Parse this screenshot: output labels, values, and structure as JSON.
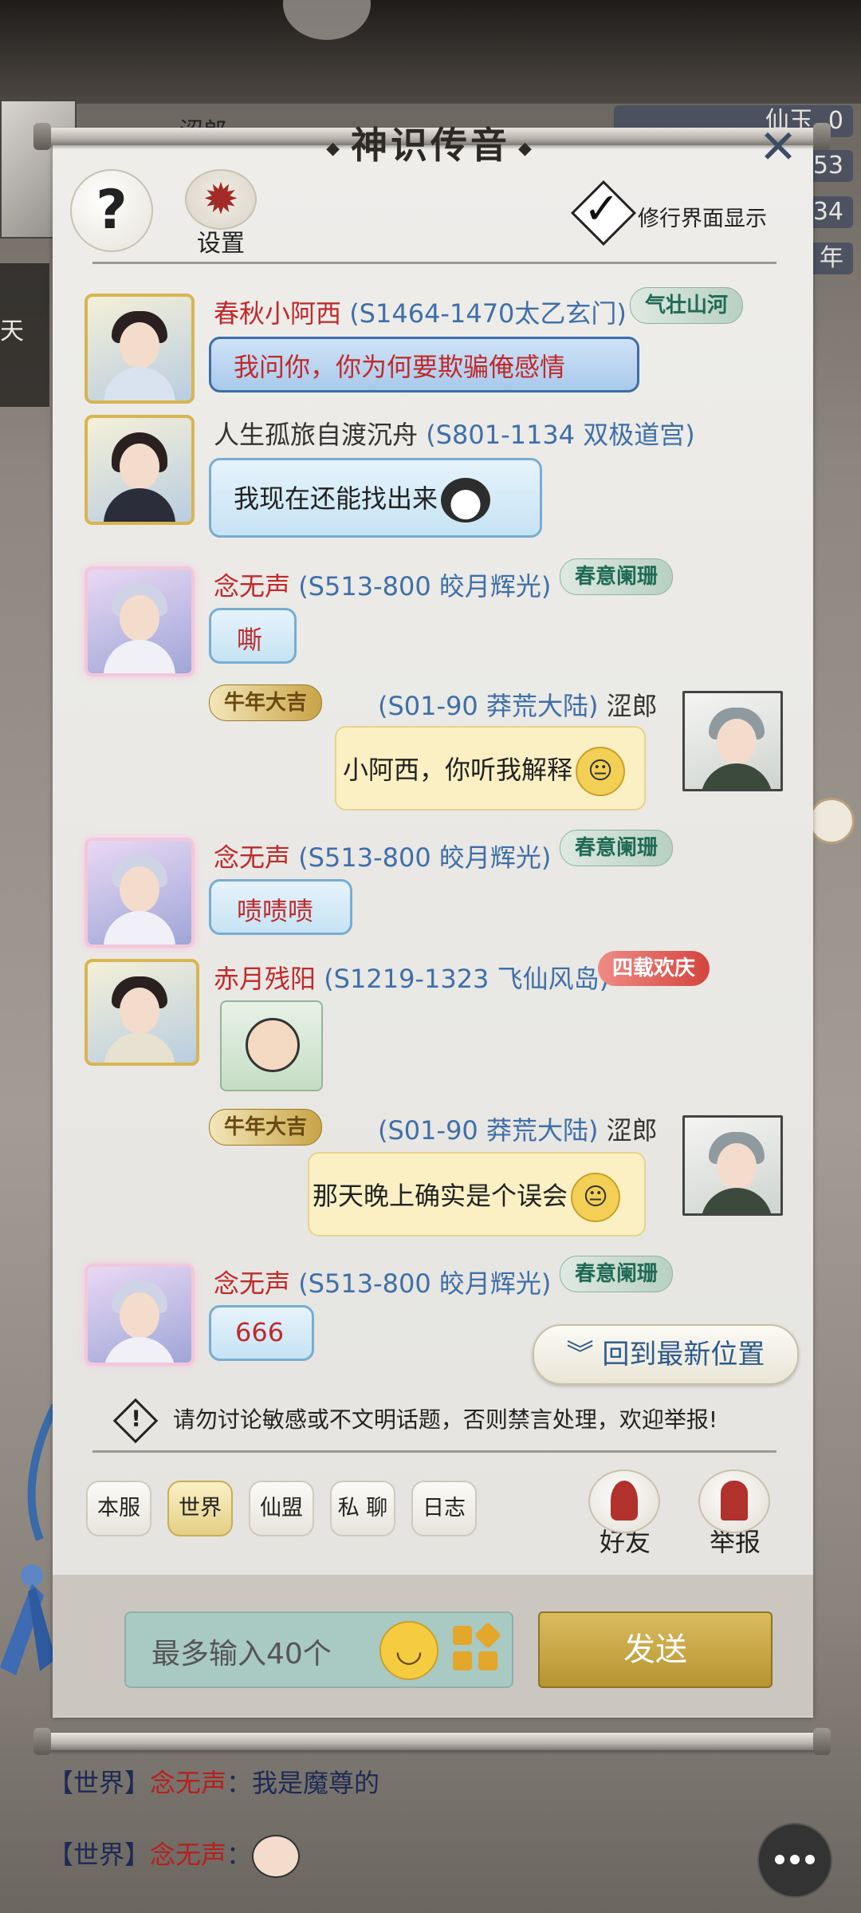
{
  "background": {
    "player_name": "涩郎",
    "stats": [
      "仙玉",
      "0",
      "53",
      "34",
      "年"
    ],
    "side_label": "天",
    "chat_preview": [
      {
        "channel": "【世界】",
        "sender": "念无声",
        "text": "我是魔尊的"
      },
      {
        "channel": "【世界】",
        "sender": "念无声",
        "text": ""
      }
    ]
  },
  "panel": {
    "title": "神识传音",
    "close_icon": "close-icon",
    "settings_label": "设置",
    "display_toggle_label": "修行界面显示",
    "display_toggle_checked": true
  },
  "messages": [
    {
      "name": "春秋小阿西",
      "server": "(S1464-1470太乙玄门)",
      "badge": "气壮山河",
      "text": "我问你，你为何要欺骗俺感情",
      "side": "left"
    },
    {
      "name": "人生孤旅自渡沉舟",
      "server": "(S801-1134 双极道宫)",
      "badge": "",
      "text": "我现在还能找出来",
      "side": "left"
    },
    {
      "name": "念无声",
      "server": "(S513-800 皎月辉光)",
      "badge": "春意阑珊",
      "text": "嘶",
      "side": "left"
    },
    {
      "name": "涩郎",
      "server": "(S01-90 莽荒大陆)",
      "badge": "牛年大吉",
      "text": "小阿西，你听我解释",
      "side": "right"
    },
    {
      "name": "念无声",
      "server": "(S513-800 皎月辉光)",
      "badge": "春意阑珊",
      "text": "啧啧啧",
      "side": "left"
    },
    {
      "name": "赤月残阳",
      "server": "(S1219-1323 飞仙风岛)",
      "badge": "四载欢庆",
      "text": "",
      "side": "left"
    },
    {
      "name": "涩郎",
      "server": "(S01-90 莽荒大陆)",
      "badge": "牛年大吉",
      "text": "那天晚上确实是个误会",
      "side": "right"
    },
    {
      "name": "念无声",
      "server": "(S513-800 皎月辉光)",
      "badge": "春意阑珊",
      "text": "666",
      "side": "left"
    }
  ],
  "back_to_latest": "回到最新位置",
  "warning": "请勿讨论敏感或不文明话题，否则禁言处理，欢迎举报!",
  "tabs": [
    {
      "label": "本服",
      "active": false
    },
    {
      "label": "世界",
      "active": true
    },
    {
      "label": "仙盟",
      "active": false
    },
    {
      "label": "私 聊",
      "active": false
    },
    {
      "label": "日志",
      "active": false
    }
  ],
  "actions": {
    "friends": "好友",
    "report": "举报"
  },
  "input": {
    "placeholder": "最多输入40个",
    "send": "发送"
  },
  "colors": {
    "accent_gold": "#c8a447",
    "name_red": "#c02a2a",
    "server_blue": "#3f6fa8"
  }
}
